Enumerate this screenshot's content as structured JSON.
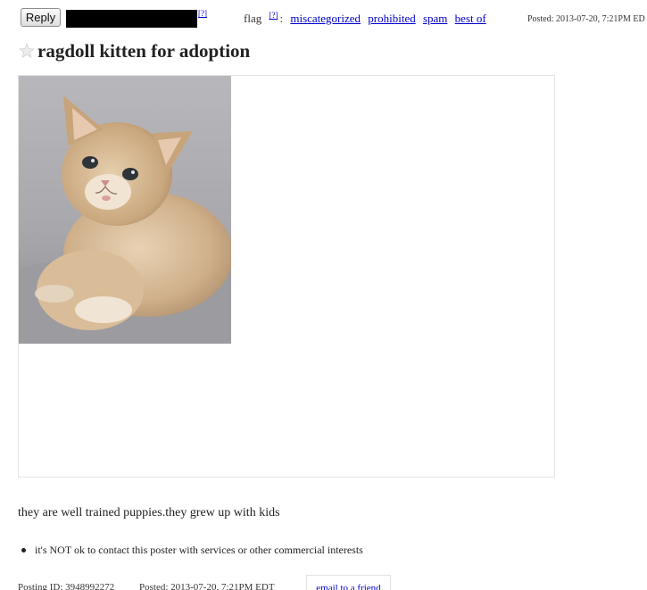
{
  "toolbar": {
    "reply_label": "Reply",
    "redacted_help": "[?]",
    "flag_label": "flag",
    "flag_help": "[?]",
    "flag_separator": ":",
    "flag_links": [
      "miscategorized",
      "prohibited",
      "spam",
      "best of"
    ],
    "posted_label": "Posted: 2013-07-20,  7:21PM ED"
  },
  "posting": {
    "title": "ragdoll kitten for adoption",
    "body": "they are well trained puppies.they grew up with kids",
    "notice": "it's NOT ok to contact this poster with services or other commercial interests"
  },
  "footer": {
    "posting_id": "Posting ID: 3948992272",
    "posted": "Posted: 2013-07-20,  7:21PM EDT",
    "email_friend": "email to a friend"
  },
  "icons": {
    "favorite": "star-icon"
  },
  "colors": {
    "link": "#0000cc",
    "text": "#222222",
    "star": "#dddddd"
  }
}
